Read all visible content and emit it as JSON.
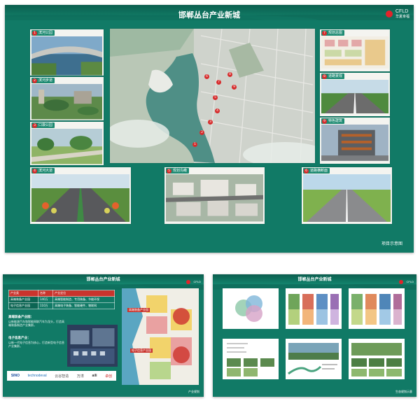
{
  "top_board": {
    "title": "邯郸丛台产业新城",
    "logo_text": "CFLD",
    "logo_sub": "华夏幸福",
    "footer_label": "项目示意图",
    "markers": [
      "1",
      "2",
      "3",
      "4",
      "5",
      "6",
      "7",
      "8",
      "9"
    ],
    "left_cards": [
      {
        "num": "1",
        "label": "滨河公园"
      },
      {
        "num": "2",
        "label": "滨河步道"
      },
      {
        "num": "3",
        "label": "口袋公园"
      }
    ],
    "right_cards": [
      {
        "num": "7",
        "label": "规划总图"
      },
      {
        "num": "8",
        "label": "道路景观"
      },
      {
        "num": "9",
        "label": "特色建筑"
      }
    ],
    "bottom_cards": [
      {
        "num": "4",
        "label": "滨河大道"
      },
      {
        "num": "5",
        "label": "规划鸟瞰"
      },
      {
        "num": "6",
        "label": "道路横断面"
      }
    ],
    "colors": {
      "board": "#117a66",
      "accent": "#d62c2c",
      "logo": "#e2232a"
    }
  },
  "left_board": {
    "title": "邯郸丛台产业新城",
    "logo_text": "CFLD",
    "table": {
      "header": [
        "产业类",
        "名称",
        "产业定位"
      ],
      "rows": [
        [
          "高端装备产业园",
          "140万",
          "高端智能制造、专用装备、节能环保"
        ],
        [
          "电子信息产业园",
          "110万",
          "高端电子装备、智能硬件、物联网"
        ]
      ]
    },
    "note_1_title": "高端装备产业园：",
    "note_1_body": "以新能源汽车和智能网联汽车为龙头，打造高端装备制造产业集群。",
    "note_2_title": "电子信息产业：",
    "note_2_body": "以新一代电子信息为核心，打造新型电子信息产业集群。",
    "map_label_1": "高端装备产业园",
    "map_label_2": "电子信息产业园",
    "brands": [
      "SINO",
      "technodeval",
      "云谷智造",
      "万洋",
      "aili",
      "卓创"
    ],
    "footer_label": "产业规划"
  },
  "right_board": {
    "title": "邯郸丛台产业新城",
    "logo_text": "CFLD",
    "footer_label": "生态规划示意"
  }
}
